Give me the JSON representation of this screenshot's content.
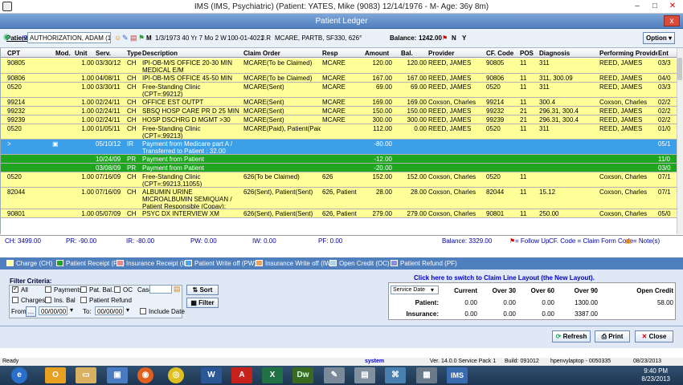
{
  "window": {
    "title": "IMS (IMS, Psychiatric)     (Patient: YATES, Mike  (9083) 12/14/1976 - M- Age: 36y 8m)",
    "min": "–",
    "max": "□",
    "close": "✕"
  },
  "ledger": {
    "title": "Patient Ledger",
    "close": "x"
  },
  "patient": {
    "label": "Patient*",
    "help": "(?)",
    "name": "AUTHORIZATION, ADAM (1",
    "sex": "M",
    "dob": "1/3/1973 40 Yr 7 Mo 2 W",
    "account": "100-01-4021",
    "initials": "J.R",
    "insurance": "MCARE, PARTB, SF330, 626°",
    "balance_label": "Balance:",
    "balance": "1242.00",
    "p": "P",
    "n": "N",
    "y": "Y",
    "option": "Option"
  },
  "columns": [
    "CPT",
    "Mod.",
    "Unit",
    "Serv.",
    "Type",
    "Description",
    "Claim Order",
    "Resp",
    "Amount",
    "Bal.",
    "Provider",
    "CF. Code",
    "POS",
    "Diagnosis",
    "Performing Provider",
    "Ent"
  ],
  "rows": [
    {
      "cpt": "90805",
      "mod": "",
      "unit": "1.00",
      "serv": "03/30/12",
      "type": "CH",
      "desc": "IPI-OB-M/S OFFICE 20-30 MIN MEDICAL E/M",
      "claim": "MCARE(To be Claimed)",
      "resp": "MCARE",
      "amount": "120.00",
      "bal": "120.00",
      "provider": "REED, JAMES",
      "cf": "90805",
      "pos": "11",
      "diag": "311",
      "perf": "REED, JAMES",
      "ent": "03/3"
    },
    {
      "cpt": "90806",
      "mod": "",
      "unit": "1.00",
      "serv": "04/08/11",
      "type": "CH",
      "desc": "IPI-OB-M/S OFFICE 45-50 MIN",
      "claim": "MCARE(To be Claimed)",
      "resp": "MCARE",
      "amount": "167.00",
      "bal": "167.00",
      "provider": "REED, JAMES",
      "cf": "90806",
      "pos": "11",
      "diag": "311, 300.09",
      "perf": "REED, JAMES",
      "ent": "04/0"
    },
    {
      "cpt": "0520",
      "mod": "",
      "unit": "1.00",
      "serv": "03/30/11",
      "type": "CH",
      "desc": "Free-Standing Clinic (CPT=:99212)",
      "claim": "MCARE(Sent)",
      "resp": "MCARE",
      "amount": "69.00",
      "bal": "69.00",
      "provider": "REED, JAMES",
      "cf": "0520",
      "pos": "11",
      "diag": "311",
      "perf": "REED, JAMES",
      "ent": "03/3"
    },
    {
      "cpt": "99214",
      "mod": "",
      "unit": "1.00",
      "serv": "02/24/11",
      "type": "CH",
      "desc": "OFFICE EST OUTPT",
      "claim": "MCARE(Sent)",
      "resp": "MCARE",
      "amount": "169.00",
      "bal": "169.00",
      "provider": "Coxson, Charles",
      "cf": "99214",
      "pos": "11",
      "diag": "300.4",
      "perf": "Coxson, Charles",
      "ent": "02/2"
    },
    {
      "cpt": "99232",
      "mod": "",
      "unit": "1.00",
      "serv": "02/24/11",
      "type": "CH",
      "desc": "SBSQ HOSP CARE PR D 25 MIN",
      "claim": "MCARE(Sent)",
      "resp": "MCARE",
      "amount": "150.00",
      "bal": "150.00",
      "provider": "REED, JAMES",
      "cf": "99232",
      "pos": "21",
      "diag": "296.31, 300.4",
      "perf": "REED, JAMES",
      "ent": "02/2"
    },
    {
      "cpt": "99239",
      "mod": "",
      "unit": "1.00",
      "serv": "02/24/11",
      "type": "CH",
      "desc": "HOSP DSCHRG D MGMT >30 MIN",
      "claim": "MCARE(Sent)",
      "resp": "MCARE",
      "amount": "300.00",
      "bal": "300.00",
      "provider": "REED, JAMES",
      "cf": "99239",
      "pos": "21",
      "diag": "296.31, 300.4",
      "perf": "REED, JAMES",
      "ent": "02/2"
    },
    {
      "cpt": "0520",
      "mod": "",
      "unit": "1.00",
      "serv": "01/05/11",
      "type": "CH",
      "desc": "Free-Standing Clinic (CPT=:99213)",
      "claim": "MCARE(Paid), Patient(Paid)",
      "resp": "",
      "amount": "112.00",
      "bal": "0.00",
      "provider": "REED, JAMES",
      "cf": "0520",
      "pos": "11",
      "diag": "311",
      "perf": "REED, JAMES",
      "ent": "01/0"
    },
    {
      "cpt": ">",
      "mod": "",
      "unit": "",
      "serv": "05/10/12",
      "type": "IR",
      "desc": "Payment from Medicare part A / Transferred to Patient : 32.00",
      "claim": "",
      "resp": "",
      "amount": "-80.00",
      "bal": "",
      "provider": "",
      "cf": "",
      "pos": "",
      "diag": "",
      "perf": "",
      "ent": "05/1"
    },
    {
      "cpt": "",
      "mod": "",
      "unit": "",
      "serv": "10/24/09",
      "type": "PR",
      "desc": "Payment from Patient",
      "claim": "",
      "resp": "",
      "amount": "-12.00",
      "bal": "",
      "provider": "",
      "cf": "",
      "pos": "",
      "diag": "",
      "perf": "",
      "ent": "11/0"
    },
    {
      "cpt": "",
      "mod": "",
      "unit": "",
      "serv": "03/08/09",
      "type": "PR",
      "desc": "Payment from Patient",
      "claim": "",
      "resp": "",
      "amount": "-20.00",
      "bal": "",
      "provider": "",
      "cf": "",
      "pos": "",
      "diag": "",
      "perf": "",
      "ent": "03/0"
    },
    {
      "cpt": "0520",
      "mod": "",
      "unit": "1.00",
      "serv": "07/16/09",
      "type": "CH",
      "desc": "Free-Standing Clinic (CPT=:99213,11055)",
      "claim": "626(To be Claimed)",
      "resp": "626",
      "amount": "152.00",
      "bal": "152.00",
      "provider": "Coxson, Charles",
      "cf": "0520",
      "pos": "11",
      "diag": "",
      "perf": "Coxson, Charles",
      "ent": "07/1"
    },
    {
      "cpt": "82044",
      "mod": "",
      "unit": "1.00",
      "serv": "07/16/09",
      "type": "CH",
      "desc": "ALBUMIN URINE MICROALBUMIN SEMIQUAN / Patient Responsible (Copay): 20.00",
      "claim": "626(Sent), Patient(Sent)",
      "resp": "626, Patient",
      "amount": "28.00",
      "bal": "28.00",
      "provider": "Coxson, Charles",
      "cf": "82044",
      "pos": "11",
      "diag": "15.12",
      "perf": "Coxson, Charles",
      "ent": "07/1"
    },
    {
      "cpt": "90801",
      "mod": "",
      "unit": "1.00",
      "serv": "05/07/09",
      "type": "CH",
      "desc": "PSYC DX INTERVIEW XM",
      "claim": "626(Sent), Patient(Sent)",
      "resp": "626, Patient",
      "amount": "279.00",
      "bal": "279.00",
      "provider": "Coxson, Charles",
      "cf": "90801",
      "pos": "11",
      "diag": "250.00",
      "perf": "Coxson, Charles",
      "ent": "05/0"
    }
  ],
  "totals": {
    "ch": "CH: 3499.00",
    "pr": "PR: -90.00",
    "ir": "IR: -80.00",
    "pw": "PW: 0.00",
    "iw": "IW: 0.00",
    "pf": "PF: 0.00",
    "balance": "Balance: 3329.00",
    "flag_note": "= Follow Up",
    "cf_note": "CF. Code = Claim Form Code",
    "note_note": "= Note(s)"
  },
  "legend": [
    {
      "label": "Charge  (CH)",
      "color": "#ffff99"
    },
    {
      "label": "Patient Receipt  (PR)",
      "color": "#1fa51f"
    },
    {
      "label": "Insurance Receipt  (IR)",
      "color": "#e88a8a"
    },
    {
      "label": "Patient Write off  (PW)",
      "color": "#4aa8e8"
    },
    {
      "label": "Insurance Write off  (IW)",
      "color": "#f0a050"
    },
    {
      "label": "Open Credit  (OC)",
      "color": "#a8d8f0"
    },
    {
      "label": "Patient Refund  (PF)",
      "color": "#8b8be8"
    }
  ],
  "filter": {
    "title": "Filter Criteria:",
    "all": "All",
    "payments": "Payments",
    "pat_bal": "Pat. Bal.",
    "oc": "OC",
    "charges": "Charges",
    "ins_bal": "Ins. Bal",
    "patient_refund": "Patient Refund",
    "case": "Case",
    "from": "From:",
    "to": "To:",
    "from_date": "00/00/00",
    "to_date": "00/00/00",
    "include_date": "Include Date",
    "sort": "Sort",
    "filter_btn": "Filter"
  },
  "claim_link": "Click here to switch to Claim Line Layout (the New Layout).",
  "balance_table": {
    "select": "Service Date",
    "headers": [
      "Current",
      "Over 30",
      "Over 60",
      "Over 90",
      "Open Credit"
    ],
    "rows": [
      {
        "label": "Patient:",
        "vals": [
          "0.00",
          "0.00",
          "0.00",
          "1300.00",
          "58.00"
        ]
      },
      {
        "label": "Insurance:",
        "vals": [
          "0.00",
          "0.00",
          "0.00",
          "3387.00",
          ""
        ]
      }
    ]
  },
  "buttons": {
    "refresh": "Refresh",
    "print": "Print",
    "close": "Close"
  },
  "status": {
    "ready": "Ready",
    "system": "system",
    "version": "Ver. 14.0.0 Service Pack 1",
    "build": "Build: 091012",
    "host": "hpenvylaptop - 0050335",
    "date": "08/23/2013"
  },
  "taskbar": {
    "time": "9:40 PM",
    "date": "8/23/2013",
    "ims": "IMS"
  }
}
